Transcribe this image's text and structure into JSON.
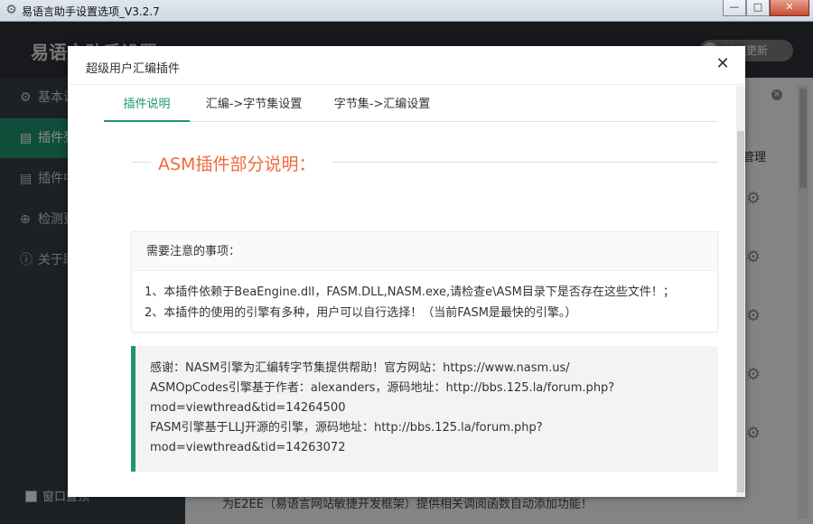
{
  "window": {
    "title": "易语言助手设置选项_V3.2.7",
    "buttons": {
      "minimize": "—",
      "maximize": "□",
      "close": "✕"
    }
  },
  "app": {
    "header_title": "易语言助手设置",
    "update_toggle_label": "检测更新",
    "sidebar": [
      {
        "label": "基本设置",
        "icon": "gear-icon",
        "active": false
      },
      {
        "label": "插件列表",
        "icon": "clipboard-icon",
        "active": true
      },
      {
        "label": "插件中心",
        "icon": "clipboard-icon",
        "active": false
      },
      {
        "label": "检测更新",
        "icon": "arrow-down-circle-icon",
        "active": false
      },
      {
        "label": "关于助手",
        "icon": "info-circle-icon",
        "active": false
      }
    ],
    "footer_checkbox_label": "窗口置顶",
    "table_header_manage": "管理",
    "bottom_text": "为E2EE（易语言网站敏捷开发框架）提供相关调阅函数自动添加功能！"
  },
  "modal": {
    "title": "超级用户汇编插件",
    "tabs": [
      {
        "label": "插件说明",
        "active": true
      },
      {
        "label": "汇编->字节集设置",
        "active": false
      },
      {
        "label": "字节集->汇编设置",
        "active": false
      }
    ],
    "section_title": "ASM插件部分说明：",
    "notice": {
      "heading": "需要注意的事项：",
      "items": [
        "1、本插件依赖于BeaEngine.dll，FASM.DLL,NASM.exe,请检查e\\ASM目录下是否存在这些文件！；",
        "2、本插件的使用的引擎有多种，用户可以自行选择！（当前FASM是最快的引擎。）"
      ]
    },
    "thanks": {
      "lines": [
        "感谢：NASM引擎为汇编转字节集提供帮助！官方网站：https://www.nasm.us/",
        "ASMOpCodes引擎基于作者：alexanders，源码地址：http://bbs.125.la/forum.php?",
        "mod=viewthread&tid=14264500",
        "FASM引擎基于LLJ开源的引擎，源码地址：http://bbs.125.la/forum.php?",
        "mod=viewthread&tid=14263072"
      ]
    }
  },
  "colors": {
    "accent": "#1f9672",
    "section_title": "#f06a3a",
    "sidebar_bg": "#383c42",
    "header_bg": "#2b2f33"
  }
}
